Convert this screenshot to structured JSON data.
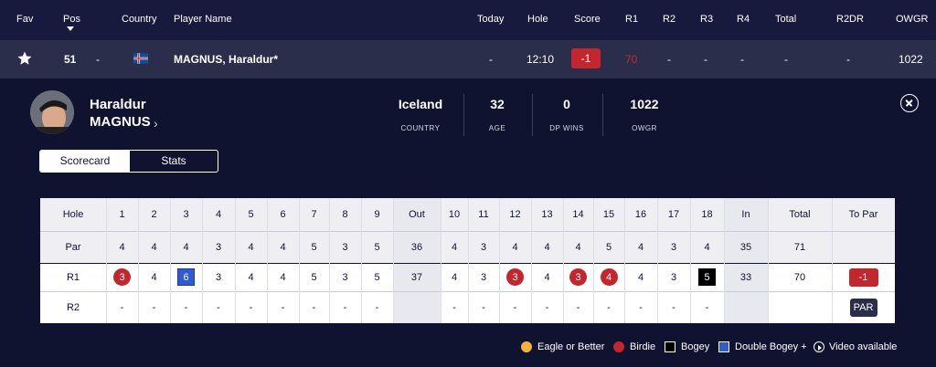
{
  "header": {
    "fav": "Fav",
    "pos": "Pos",
    "country": "Country",
    "player_name": "Player Name",
    "today": "Today",
    "hole": "Hole",
    "score": "Score",
    "r1": "R1",
    "r2": "R2",
    "r3": "R3",
    "r4": "R4",
    "total": "Total",
    "r2dr": "R2DR",
    "owgr": "OWGR"
  },
  "player_row": {
    "pos": "51",
    "pos_move": "-",
    "name": "MAGNUS, Haraldur*",
    "today": "-",
    "hole": "12:10",
    "score": "-1",
    "r1": "70",
    "r2": "-",
    "r3": "-",
    "r4": "-",
    "total": "-",
    "r2dr": "-",
    "owgr": "1022"
  },
  "profile": {
    "first_name": "Haraldur",
    "last_name": "MAGNUS",
    "chevron": "›",
    "stats": [
      {
        "value": "Iceland",
        "label": "COUNTRY"
      },
      {
        "value": "32",
        "label": "AGE"
      },
      {
        "value": "0",
        "label": "DP WINS"
      },
      {
        "value": "1022",
        "label": "OWGR"
      }
    ]
  },
  "tabs": {
    "scorecard": "Scorecard",
    "stats": "Stats"
  },
  "scorecard": {
    "hole_label": "Hole",
    "holes": [
      "1",
      "2",
      "3",
      "4",
      "5",
      "6",
      "7",
      "8",
      "9",
      "Out",
      "10",
      "11",
      "12",
      "13",
      "14",
      "15",
      "16",
      "17",
      "18",
      "In",
      "Total",
      "To Par"
    ],
    "par_label": "Par",
    "par": [
      "4",
      "4",
      "4",
      "3",
      "4",
      "4",
      "5",
      "3",
      "5",
      "36",
      "4",
      "3",
      "4",
      "4",
      "4",
      "5",
      "4",
      "3",
      "4",
      "35",
      "71",
      ""
    ],
    "rounds": [
      {
        "label": "R1",
        "scores": [
          "3",
          "4",
          "6",
          "3",
          "4",
          "4",
          "5",
          "3",
          "5",
          "37",
          "4",
          "3",
          "3",
          "4",
          "3",
          "4",
          "4",
          "3",
          "5",
          "33",
          "70",
          "-1"
        ],
        "styles": [
          "birdie",
          "",
          "double",
          "",
          "",
          "",
          "",
          "",
          "",
          "",
          "",
          "",
          "birdie",
          "",
          "birdie",
          "birdie",
          "",
          "",
          "bogey",
          "",
          "",
          "topar-red"
        ]
      },
      {
        "label": "R2",
        "scores": [
          "-",
          "-",
          "-",
          "-",
          "-",
          "-",
          "-",
          "-",
          "-",
          "",
          "-",
          "-",
          "-",
          "-",
          "-",
          "-",
          "-",
          "-",
          "-",
          "",
          "",
          "PAR"
        ],
        "styles": [
          "",
          "",
          "",
          "",
          "",
          "",
          "",
          "",
          "",
          "",
          "",
          "",
          "",
          "",
          "",
          "",
          "",
          "",
          "",
          "",
          "",
          "topar-par"
        ]
      }
    ]
  },
  "legend": [
    {
      "label": "Eagle or Better",
      "color": "#f2b33d"
    },
    {
      "label": "Birdie",
      "color": "#c4262e"
    },
    {
      "label": "Bogey",
      "color": "#000000"
    },
    {
      "label": "Double Bogey +",
      "color": "#2f5bd0"
    },
    {
      "label": "Video available",
      "color": "#ffffff"
    }
  ]
}
